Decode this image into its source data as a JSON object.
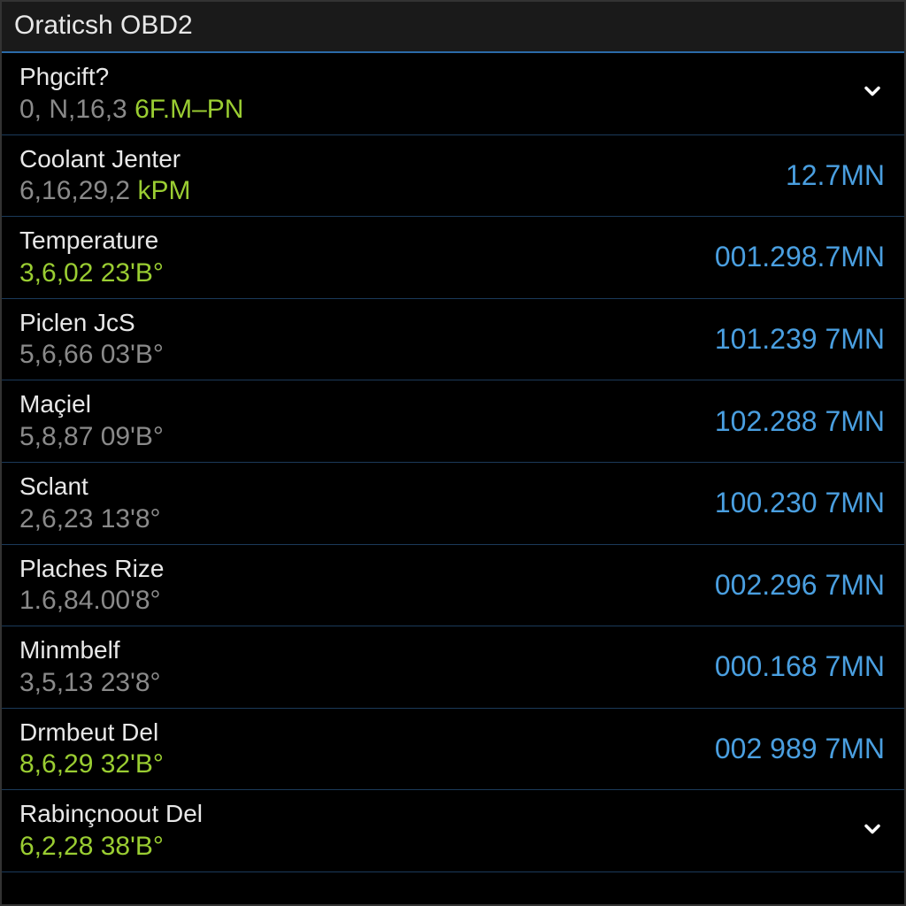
{
  "header": {
    "title": "Oraticsh OBD2"
  },
  "rows": [
    {
      "title": "Phgcift?",
      "sub_prefix": "0,  N,16,3 ",
      "sub_prefix_color": "gray",
      "sub_suffix": "6F.M–PN",
      "sub_suffix_color": "green",
      "value": "",
      "show_chevron": true
    },
    {
      "title": "Coolant Jenter",
      "sub_prefix": "6,16,29,2 ",
      "sub_prefix_color": "gray",
      "sub_suffix": "kPM",
      "sub_suffix_color": "green",
      "value": "12.7MN",
      "show_chevron": false
    },
    {
      "title": "Temperature",
      "sub_prefix": "3,6,02 23'B°",
      "sub_prefix_color": "green",
      "sub_suffix": "",
      "sub_suffix_color": "green",
      "value": "001.298.7MN",
      "show_chevron": false
    },
    {
      "title": "Piclen JcS",
      "sub_prefix": "5,6,66 03'B°",
      "sub_prefix_color": "gray",
      "sub_suffix": "",
      "sub_suffix_color": "gray",
      "value": "101.239 7MN",
      "show_chevron": false
    },
    {
      "title": "Maçiel",
      "sub_prefix": "5,8,87 09'B°",
      "sub_prefix_color": "gray",
      "sub_suffix": "",
      "sub_suffix_color": "gray",
      "value": "102.288 7MN",
      "show_chevron": false
    },
    {
      "title": "Sclant",
      "sub_prefix": "2,6,23 13'8°",
      "sub_prefix_color": "gray",
      "sub_suffix": "",
      "sub_suffix_color": "gray",
      "value": "100.230 7MN",
      "show_chevron": false
    },
    {
      "title": "Plaches Rize",
      "sub_prefix": "1.6,84.00'8°",
      "sub_prefix_color": "gray",
      "sub_suffix": "",
      "sub_suffix_color": "gray",
      "value": "002.296 7MN",
      "show_chevron": false
    },
    {
      "title": "Minmbelf",
      "sub_prefix": "3,5,13 23'8°",
      "sub_prefix_color": "gray",
      "sub_suffix": "",
      "sub_suffix_color": "gray",
      "value": "000.168 7MN",
      "show_chevron": false
    },
    {
      "title": "Drmbeut Del",
      "sub_prefix": "8,6,29 32'B°",
      "sub_prefix_color": "green",
      "sub_suffix": "",
      "sub_suffix_color": "green",
      "value": "002 989 7MN",
      "show_chevron": false
    },
    {
      "title": "Rabinçnoout Del",
      "sub_prefix": "6,2,28 38'B°",
      "sub_prefix_color": "green",
      "sub_suffix": "",
      "sub_suffix_color": "green",
      "value": "",
      "show_chevron": true
    }
  ]
}
